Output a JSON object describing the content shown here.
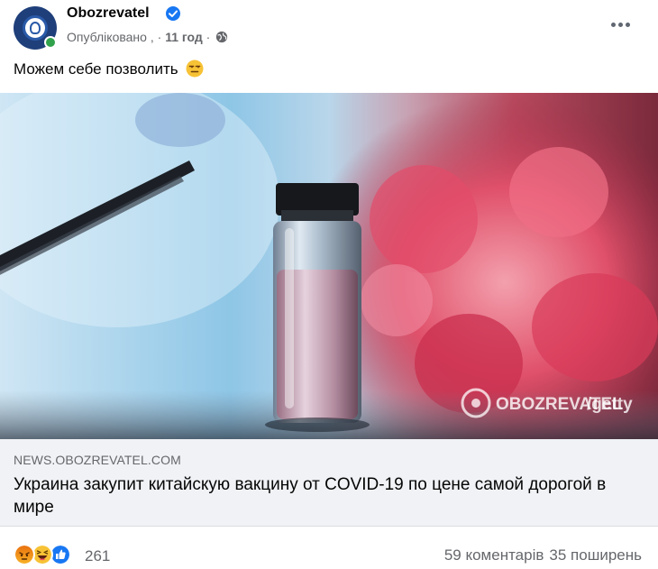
{
  "post": {
    "page_name": "Obozrevatel",
    "published_label": "Опубліковано",
    "separator": ",",
    "dot": "·",
    "time": "11 год",
    "dot2": "·",
    "text": "Можем себе позволить"
  },
  "image": {
    "watermark_brand": "OBOZREVATEL",
    "watermark_source": "/getty"
  },
  "link": {
    "domain": "NEWS.OBOZREVATEL.COM",
    "title": "Украина закупит китайскую вакцину от COVID-19 по цене самой дорогой в мире"
  },
  "footer": {
    "reaction_count": "261",
    "comments": "59 коментарів",
    "shares": "35 поширень"
  },
  "colors": {
    "verified": "#1877f2",
    "angry": "#e9710f",
    "like": "#1877f2",
    "online": "#31a24c"
  }
}
